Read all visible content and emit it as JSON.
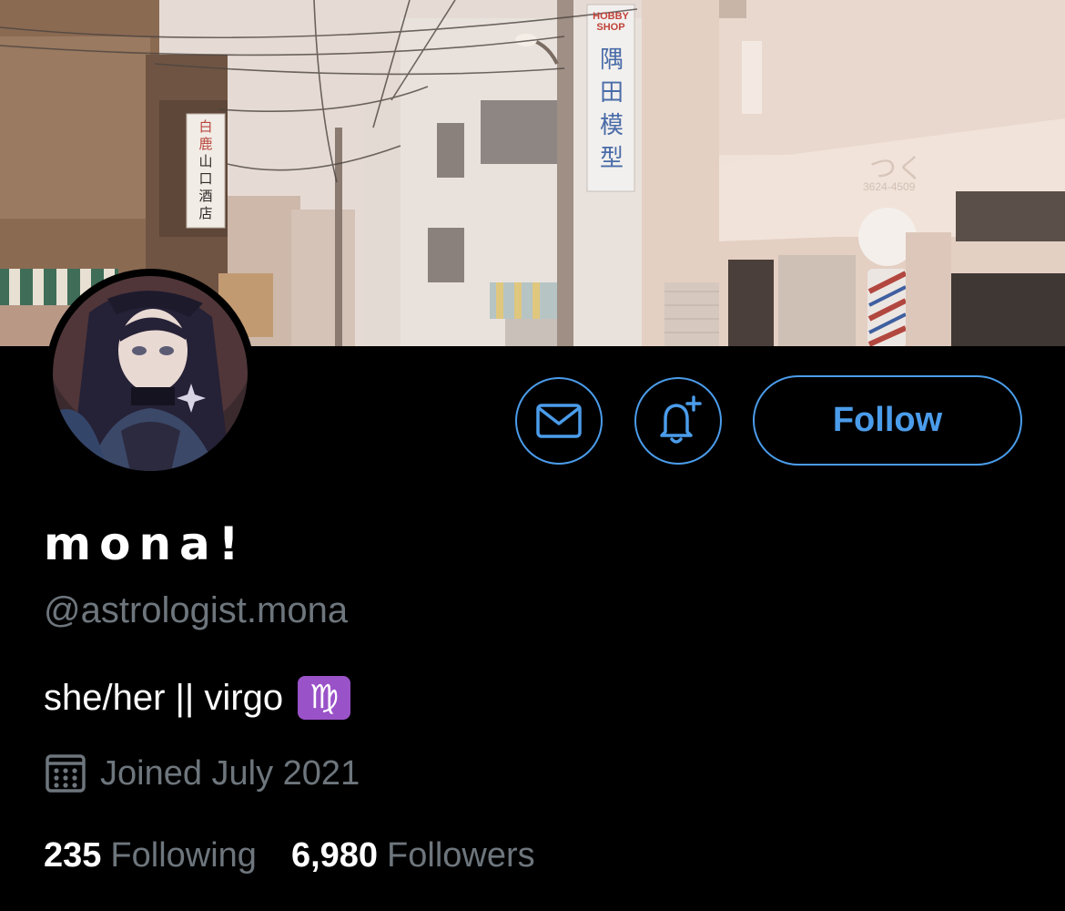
{
  "profile": {
    "display_name": "mona!",
    "handle": "@astrologist.mona",
    "bio": "she/her || virgo",
    "bio_emoji": "♍",
    "joined": "Joined July 2021",
    "following_count": "235",
    "following_label": "Following",
    "followers_count": "6,980",
    "followers_label": "Followers"
  },
  "actions": {
    "message_icon": "envelope-icon",
    "notify_icon": "bell-plus-icon",
    "follow_label": "Follow"
  },
  "banner": {
    "shop_sign_top": "HOBBY SHOP",
    "shop_sign_kanji": [
      "隅",
      "田",
      "模",
      "型"
    ],
    "left_sign_kanji": [
      "白",
      "鹿",
      "山",
      "口",
      "酒",
      "店"
    ],
    "awning_sign": "つく",
    "awning_sign_phone": "3624-4509"
  },
  "colors": {
    "accent": "#4b9cea",
    "background": "#000000",
    "muted_text": "#6e767d",
    "emoji_badge": "#9a52c8"
  }
}
